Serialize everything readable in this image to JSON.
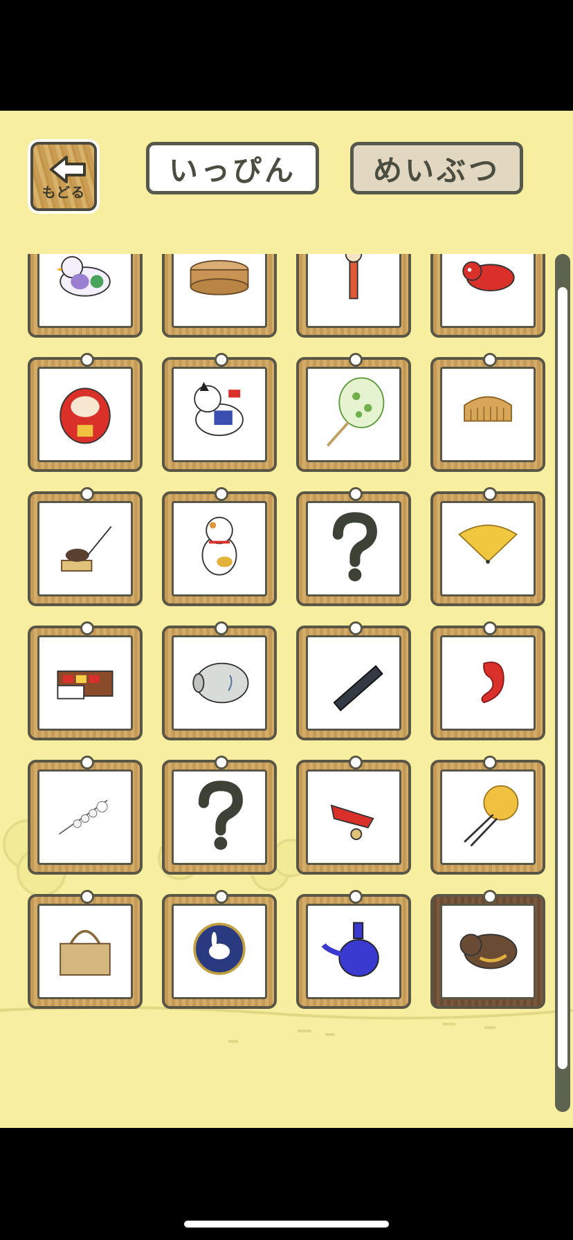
{
  "header": {
    "back_label": "もどる",
    "tab_ippin": "いっぴん",
    "tab_meibutsu": "めいぶつ",
    "active_tab": "めいぶつ"
  },
  "items": [
    {
      "name": "dove-whistle-icon",
      "known": true
    },
    {
      "name": "bento-box-icon",
      "known": true
    },
    {
      "name": "kokeshi-doll-icon",
      "known": true
    },
    {
      "name": "akabeko-cow-icon",
      "known": true
    },
    {
      "name": "daruma-icon",
      "known": true
    },
    {
      "name": "inu-hariko-dog-icon",
      "known": true
    },
    {
      "name": "uchiwa-fan-icon",
      "known": true
    },
    {
      "name": "wooden-comb-icon",
      "known": true
    },
    {
      "name": "mouse-trap-toy-icon",
      "known": true
    },
    {
      "name": "maneki-neko-icon",
      "known": true
    },
    {
      "name": "unknown-item-icon",
      "known": false
    },
    {
      "name": "folding-fan-icon",
      "known": true
    },
    {
      "name": "sweets-box-icon",
      "known": true
    },
    {
      "name": "pig-mosquito-coil-icon",
      "known": true
    },
    {
      "name": "ink-stick-icon",
      "known": true
    },
    {
      "name": "red-bean-magatama-icon",
      "known": true
    },
    {
      "name": "hair-ornament-kanzashi-icon",
      "known": true
    },
    {
      "name": "unknown-item-icon",
      "known": false
    },
    {
      "name": "koi-pull-toy-icon",
      "known": true
    },
    {
      "name": "hair-pin-icon",
      "known": true
    },
    {
      "name": "woven-basket-bag-icon",
      "known": true
    },
    {
      "name": "rabbit-plate-icon",
      "known": true
    },
    {
      "name": "blue-sake-bottle-icon",
      "known": true
    },
    {
      "name": "carved-bear-icon",
      "known": true
    },
    {
      "name": "blue-glass-cup-icon",
      "known": true
    }
  ],
  "colors": {
    "background": "#f7ee9f",
    "frame": "#c49a56",
    "dark_frame": "#6a4b34",
    "outline": "#5a5646"
  }
}
